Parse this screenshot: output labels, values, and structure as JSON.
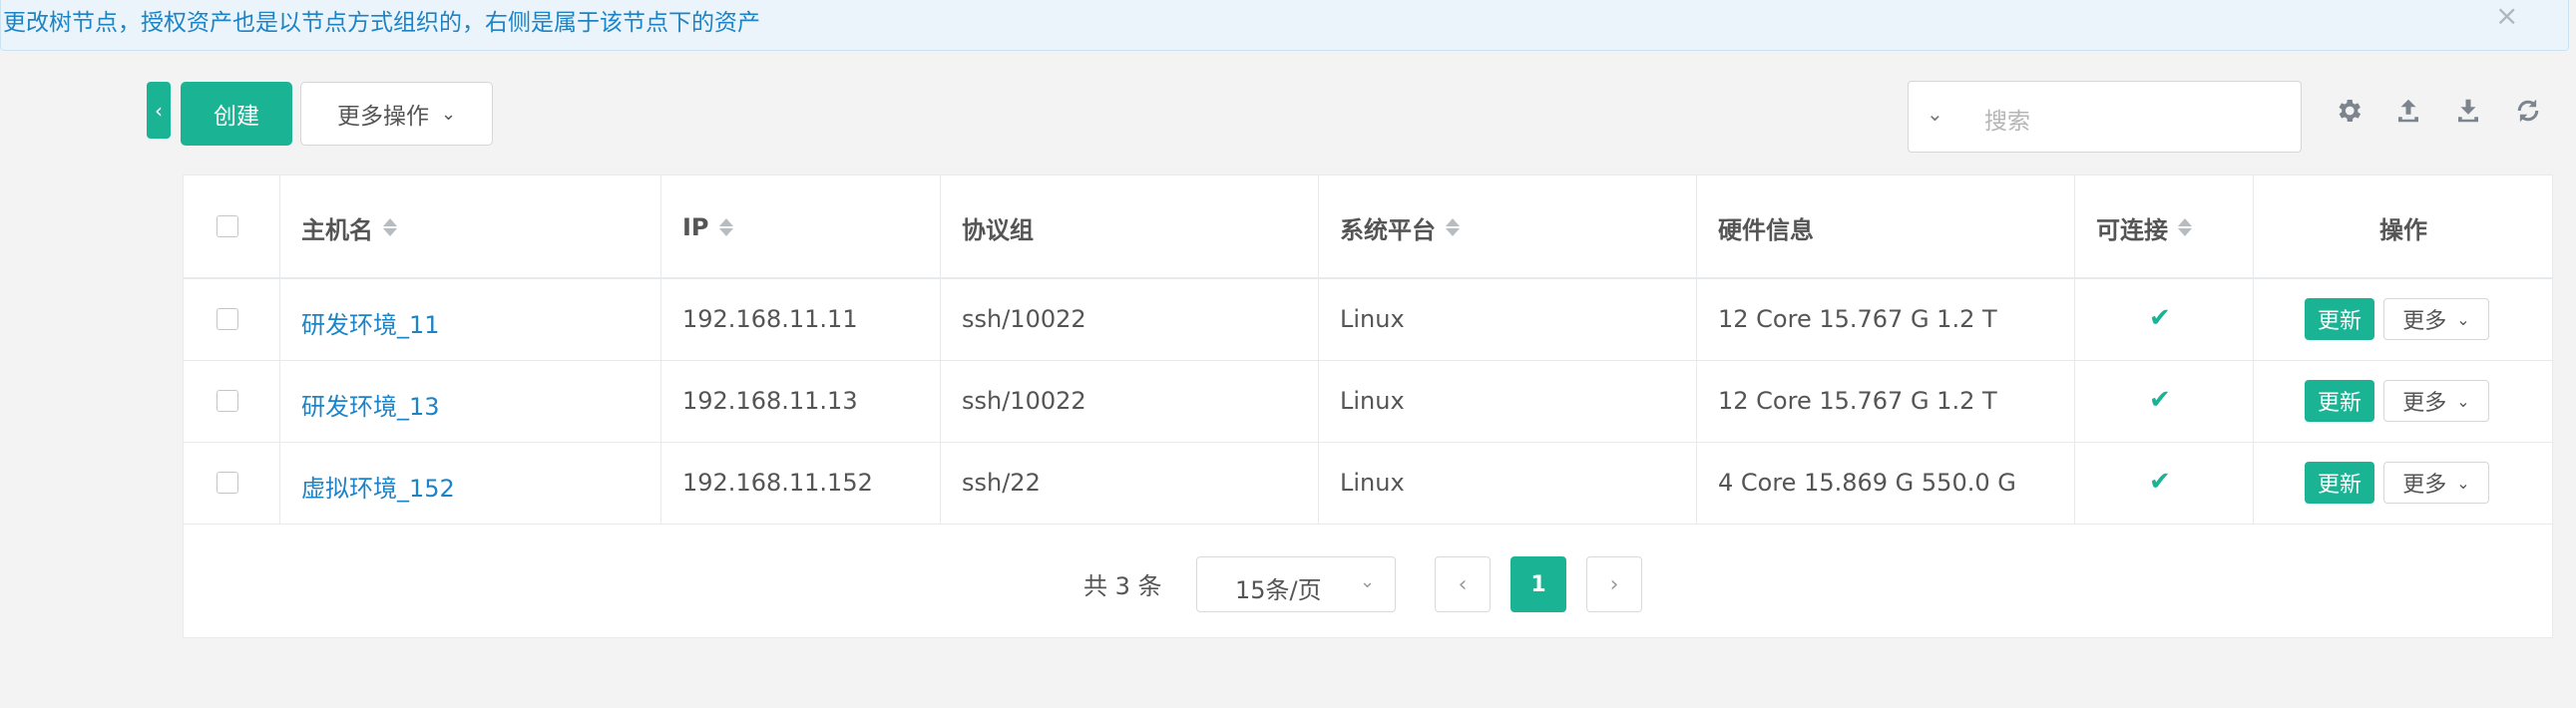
{
  "notice": {
    "text": "更改树节点，授权资产也是以节点方式组织的，右侧是属于该节点下的资产",
    "close_glyph": "×"
  },
  "toolbar": {
    "toggle_glyph": "‹",
    "create_label": "创建",
    "more_actions_label": "更多操作",
    "search_placeholder": "搜索",
    "icons": [
      "gear-icon",
      "upload-icon",
      "download-icon",
      "refresh-icon"
    ]
  },
  "table": {
    "columns": [
      {
        "label": "主机名",
        "sortable": true
      },
      {
        "label": "IP",
        "sortable": true
      },
      {
        "label": "协议组",
        "sortable": false
      },
      {
        "label": "系统平台",
        "sortable": true
      },
      {
        "label": "硬件信息",
        "sortable": false
      },
      {
        "label": "可连接",
        "sortable": true
      },
      {
        "label": "操作",
        "sortable": false
      }
    ],
    "rows": [
      {
        "hostname": "研发环境_11",
        "ip": "192.168.11.11",
        "protocols": "ssh/10022",
        "platform": "Linux",
        "hardware": "12 Core 15.767 G 1.2 T",
        "connectable": true,
        "update_label": "更新",
        "more_label": "更多"
      },
      {
        "hostname": "研发环境_13",
        "ip": "192.168.11.13",
        "protocols": "ssh/10022",
        "platform": "Linux",
        "hardware": "12 Core 15.767 G 1.2 T",
        "connectable": true,
        "update_label": "更新",
        "more_label": "更多"
      },
      {
        "hostname": "虚拟环境_152",
        "ip": "192.168.11.152",
        "protocols": "ssh/22",
        "platform": "Linux",
        "hardware": "4 Core 15.869 G 550.0 G",
        "connectable": true,
        "update_label": "更新",
        "more_label": "更多"
      }
    ]
  },
  "pagination": {
    "total_text": "共 3 条",
    "page_size": "15条/页",
    "current_page": "1"
  },
  "colors": {
    "accent": "#1ab394",
    "link": "#1c84c6"
  }
}
